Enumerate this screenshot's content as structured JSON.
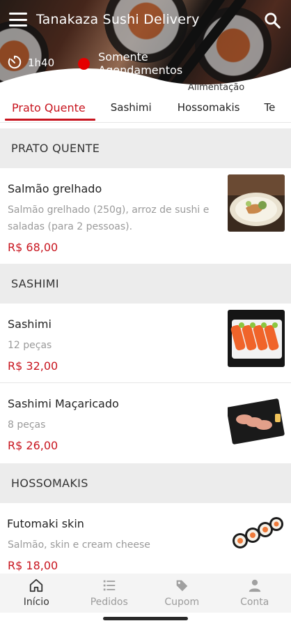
{
  "header": {
    "title": "Tanakaza Sushi Delivery",
    "eta": "1h40",
    "status": "Somente Agendamentos",
    "category_tag": "Alimentação",
    "status_color": "#e50000"
  },
  "tabs": [
    {
      "label": "Prato Quente",
      "active": true
    },
    {
      "label": "Sashimi",
      "active": false
    },
    {
      "label": "Hossomakis",
      "active": false
    },
    {
      "label": "Te",
      "active": false
    }
  ],
  "sections": [
    {
      "title": "PRATO QUENTE",
      "items": [
        {
          "name": "Salmão grelhado",
          "description": "Salmão grelhado (250g), arroz de sushi e saladas (para 2 pessoas).",
          "price": "R$ 68,00"
        }
      ]
    },
    {
      "title": "SASHIMI",
      "items": [
        {
          "name": "Sashimi",
          "description": "12 peças",
          "price": "R$ 32,00"
        },
        {
          "name": "Sashimi Maçaricado",
          "description": "8 peças",
          "price": "R$ 26,00"
        }
      ]
    },
    {
      "title": "HOSSOMAKIS",
      "items": [
        {
          "name": "Futomaki skin",
          "description": "Salmão, skin e cream cheese",
          "price": "R$ 18,00"
        }
      ]
    }
  ],
  "bottom_nav": [
    {
      "label": "Início",
      "icon": "home-icon",
      "active": true
    },
    {
      "label": "Pedidos",
      "icon": "list-icon",
      "active": false
    },
    {
      "label": "Cupom",
      "icon": "tag-icon",
      "active": false
    },
    {
      "label": "Conta",
      "icon": "person-icon",
      "active": false
    }
  ],
  "accent_color": "#c8141e"
}
